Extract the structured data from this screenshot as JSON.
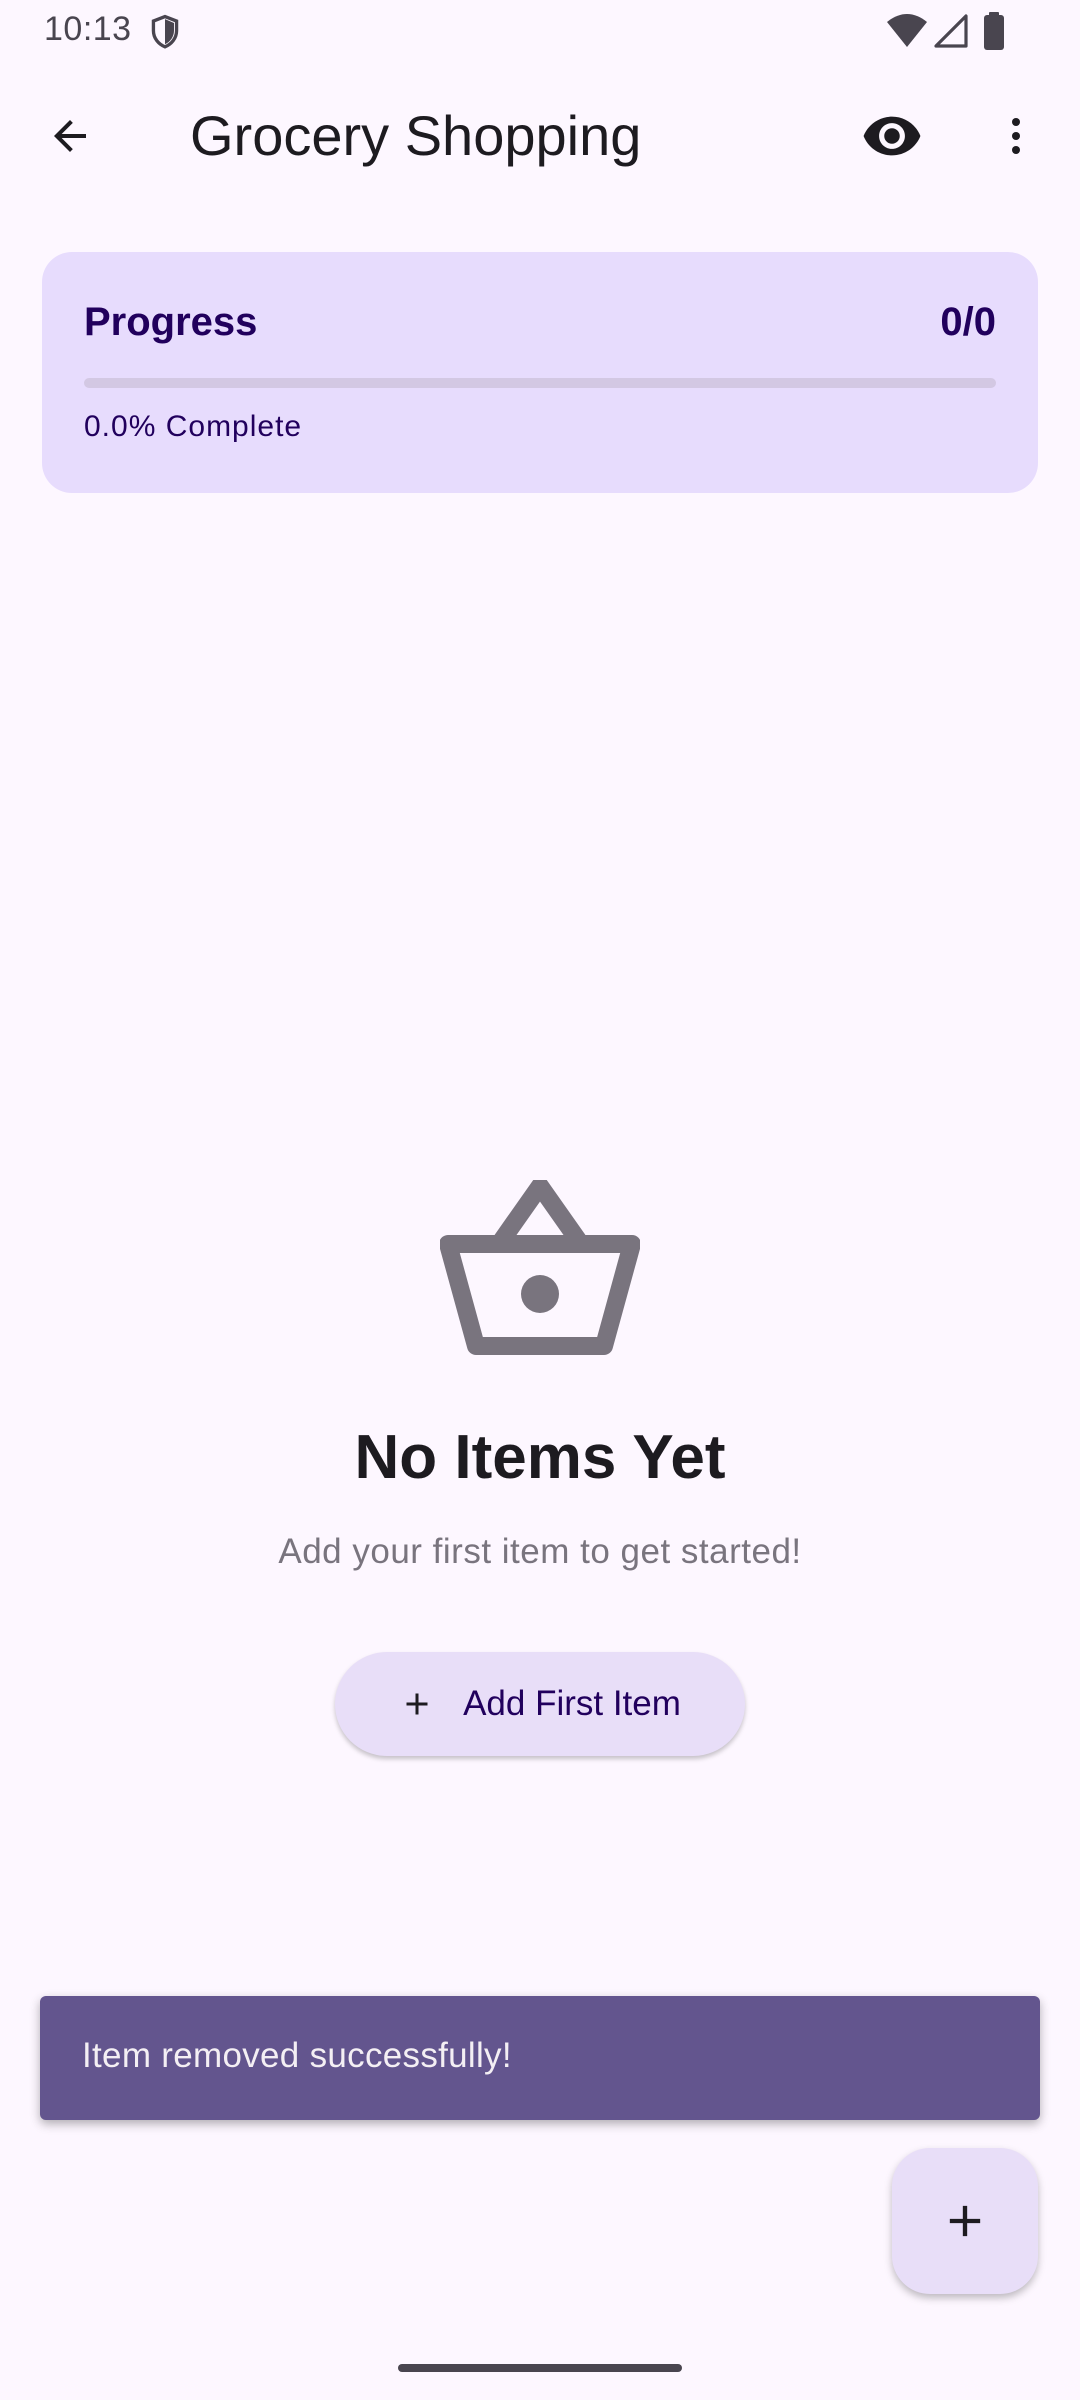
{
  "status_bar": {
    "time": "10:13",
    "icons": [
      "shield-icon",
      "wifi-icon",
      "cell-signal-icon",
      "battery-icon"
    ]
  },
  "app_bar": {
    "title": "Grocery Shopping",
    "icons": [
      "arrow-back-icon",
      "eye-icon",
      "more-vert-icon"
    ]
  },
  "progress": {
    "label": "Progress",
    "count": "0/0",
    "fraction": 0,
    "percent_text": "0.0% Complete"
  },
  "empty_state": {
    "icon": "shopping-basket-icon",
    "title": "No Items Yet",
    "subtitle": "Add your first item to get started!",
    "button_label": "Add First Item",
    "button_icon": "plus-icon"
  },
  "snackbar": {
    "message": "Item removed successfully!"
  },
  "fab": {
    "icon": "plus-icon"
  },
  "colors": {
    "background": "#FDF7FF",
    "card": "#E7DCFD",
    "primary": "#6750A4",
    "on_primary_container": "#21005D",
    "snackbar": "#63558E",
    "secondary_container": "#E8DEF8"
  }
}
